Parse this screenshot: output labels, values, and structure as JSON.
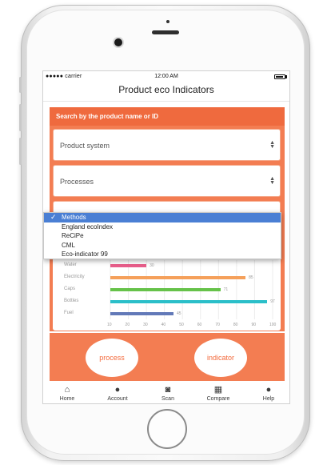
{
  "status_bar": {
    "carrier": "●●●●● carrier",
    "time": "12:00 AM"
  },
  "nav": {
    "title": "Product eco Indicators"
  },
  "search": {
    "label": "Search by the product name or ID"
  },
  "fields": [
    {
      "label": "Product system"
    },
    {
      "label": "Processes"
    }
  ],
  "methods_dropdown": {
    "options": [
      "Methods",
      "England ecoIndex",
      "ReCiPe",
      "CML",
      "Eco-indicator 99"
    ],
    "selected": "Methods",
    "check": "✓"
  },
  "chart_data": {
    "type": "bar",
    "orientation": "horizontal",
    "categories": [
      "Water",
      "Electricity",
      "Caps",
      "Bottles",
      "Fuel"
    ],
    "values": [
      30,
      85,
      71,
      97,
      45
    ],
    "colors": [
      "#e85d8a",
      "#f5a05a",
      "#66c24a",
      "#2bbfc9",
      "#6279b8"
    ],
    "x_ticks": [
      "10",
      "20",
      "30",
      "40",
      "50",
      "60",
      "70",
      "80",
      "90",
      "100"
    ],
    "xlim": [
      10,
      100
    ],
    "grid": true
  },
  "actions": {
    "process": "process",
    "indicator": "indicator"
  },
  "tabs": [
    {
      "label": "Home",
      "icon": "home-icon",
      "glyph": "⌂"
    },
    {
      "label": "Account",
      "icon": "account-icon",
      "glyph": "●"
    },
    {
      "label": "Scan",
      "icon": "camera-icon",
      "glyph": "◙"
    },
    {
      "label": "Compare",
      "icon": "grid-icon",
      "glyph": "▦"
    },
    {
      "label": "Help",
      "icon": "chat-bubble-icon",
      "glyph": "●"
    }
  ],
  "colors": {
    "accent": "#f37d52",
    "accent_dark": "#ef6a3e",
    "selection": "#4a7fd4"
  }
}
